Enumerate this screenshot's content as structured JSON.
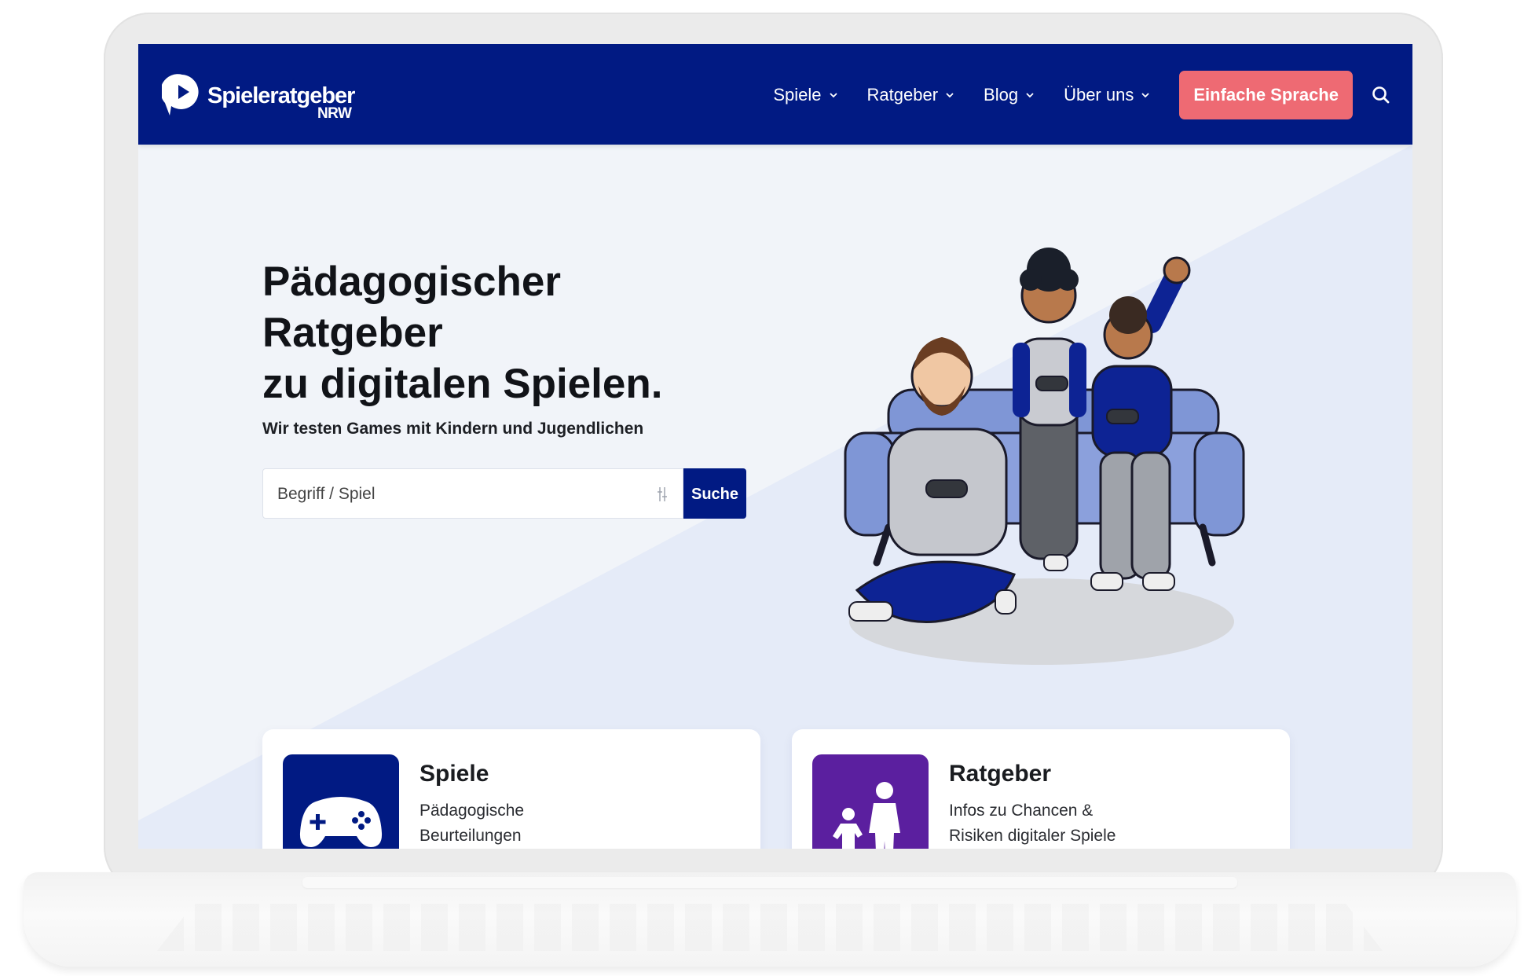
{
  "brand": {
    "name": "Spieleratgeber",
    "region": "NRW",
    "color": "#011a83"
  },
  "nav": {
    "items": [
      {
        "label": "Spiele",
        "icon": "chevron-down-icon"
      },
      {
        "label": "Ratgeber",
        "icon": "chevron-down-icon"
      },
      {
        "label": "Blog",
        "icon": "chevron-down-icon"
      },
      {
        "label": "Über uns",
        "icon": "chevron-down-icon"
      }
    ],
    "cta_label": "Einfache Sprache",
    "cta_color": "#ee6a73",
    "search_icon": "search-icon"
  },
  "hero": {
    "title_lines": [
      "Pädagogischer",
      "Ratgeber",
      "zu digitalen Spielen."
    ],
    "subtitle": "Wir testen Games mit Kindern und Jugendlichen",
    "search": {
      "placeholder": "Begriff / Spiel",
      "filter_icon": "sliders-icon",
      "button_label": "Suche"
    },
    "illustration": "family-gaming-on-sofa-illustration"
  },
  "cards": [
    {
      "title": "Spiele",
      "desc_lines": [
        "Pädagogische",
        "Beurteilungen"
      ],
      "icon": "gamepad-icon",
      "color": "#011a83"
    },
    {
      "title": "Ratgeber",
      "desc_lines": [
        "Infos zu Chancen &",
        "Risiken digitaler Spiele"
      ],
      "icon": "parent-child-icon",
      "color": "#5b1f9f"
    }
  ]
}
